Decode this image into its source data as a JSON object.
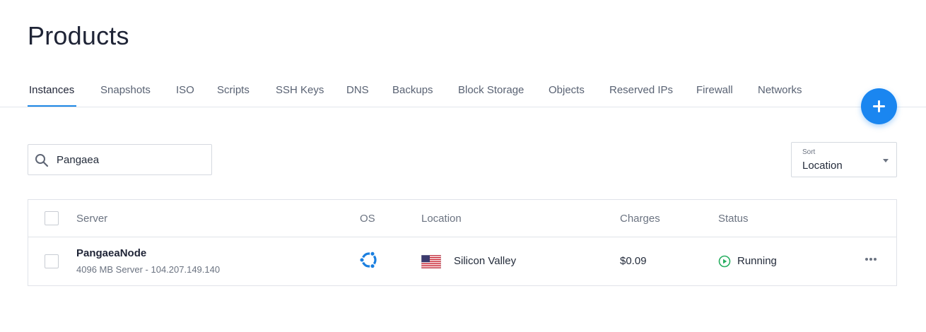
{
  "page": {
    "title": "Products"
  },
  "tabs": [
    {
      "label": "Instances",
      "active": true
    },
    {
      "label": "Snapshots"
    },
    {
      "label": "ISO"
    },
    {
      "label": "Scripts"
    },
    {
      "label": "SSH Keys"
    },
    {
      "label": "DNS"
    },
    {
      "label": "Backups"
    },
    {
      "label": "Block Storage"
    },
    {
      "label": "Objects"
    },
    {
      "label": "Reserved IPs"
    },
    {
      "label": "Firewall"
    },
    {
      "label": "Networks"
    }
  ],
  "fab": {
    "icon": "plus-icon",
    "color": "#1a86f0"
  },
  "search": {
    "icon": "search-icon",
    "value": "Pangaea"
  },
  "sort": {
    "label": "Sort",
    "value": "Location",
    "icon": "caret-down-icon"
  },
  "table": {
    "columns": {
      "server": "Server",
      "os": "OS",
      "location": "Location",
      "charges": "Charges",
      "status": "Status"
    },
    "rows": [
      {
        "name": "PangaeaNode",
        "details": "4096 MB Server - 104.207.149.140",
        "os_icon": "ubuntu-icon",
        "flag_icon": "us-flag-icon",
        "location": "Silicon Valley",
        "charges": "$0.09",
        "status": "Running",
        "status_icon": "play-circle-icon",
        "status_color": "#27ae60",
        "actions_icon": "more-horizontal-icon"
      }
    ]
  },
  "colors": {
    "accent": "#1e88e5",
    "os_blue": "#1a7fe0"
  }
}
